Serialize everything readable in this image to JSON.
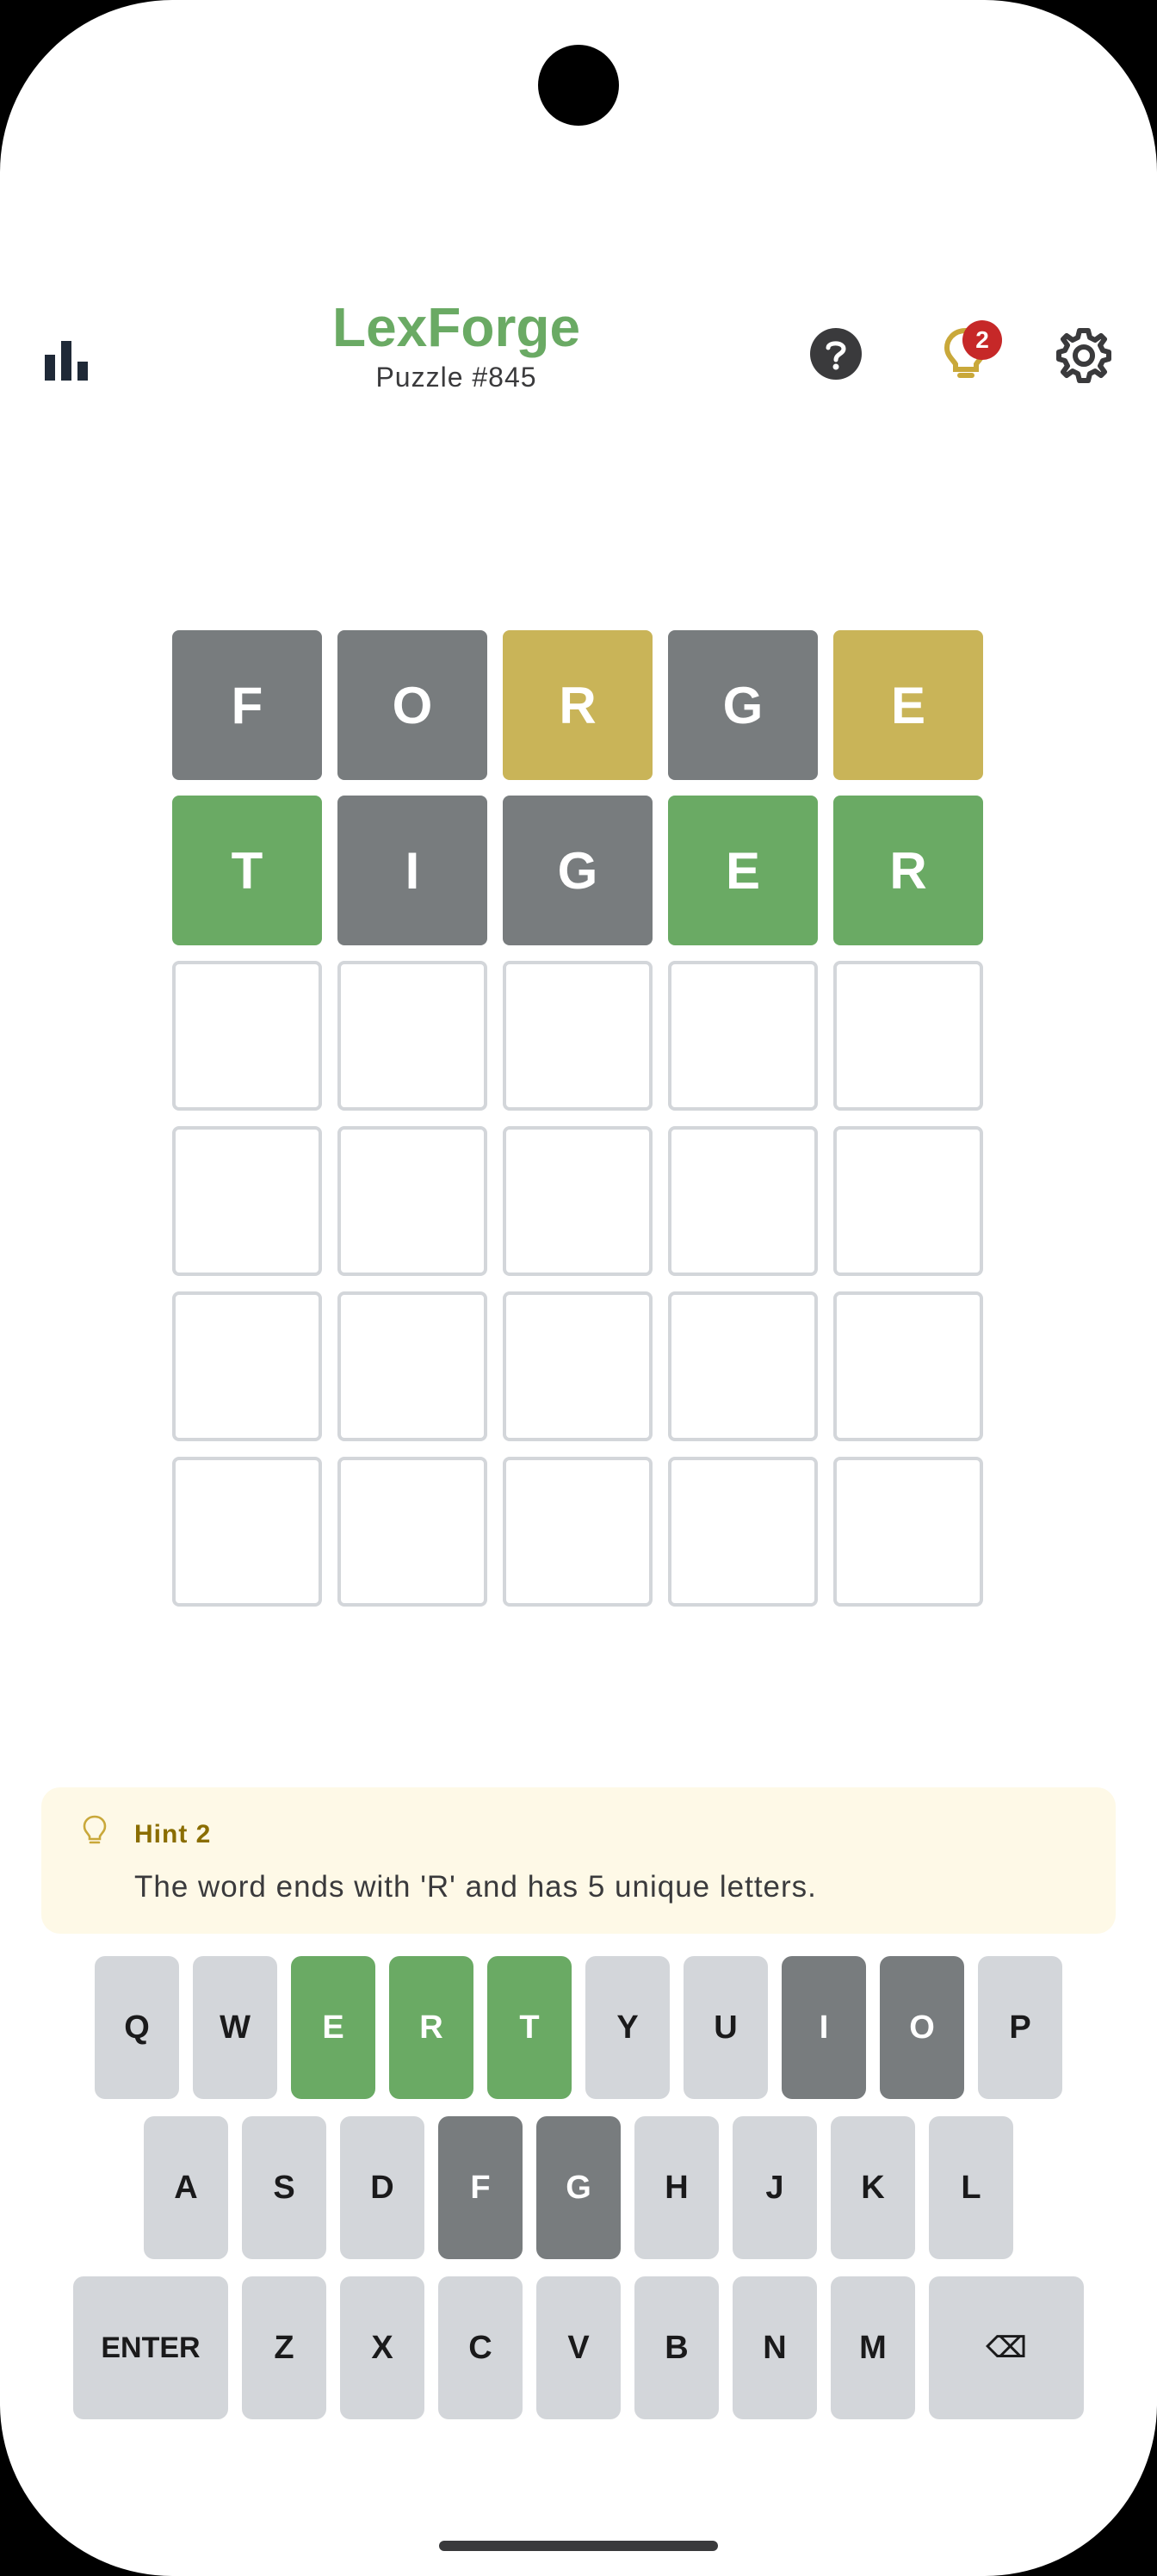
{
  "header": {
    "title": "LexForge",
    "puzzle": "Puzzle #845",
    "hint_badge": "2",
    "icons": {
      "stats": "bar-chart-icon",
      "help": "help-circle-icon",
      "hint": "lightbulb-icon",
      "settings": "gear-icon"
    }
  },
  "colors": {
    "correct": "#6aaa64",
    "present": "#c9b458",
    "absent": "#787c7e",
    "key_default": "#d3d6da",
    "badge": "#c62828"
  },
  "board": {
    "rows": [
      [
        {
          "letter": "F",
          "state": "absent"
        },
        {
          "letter": "O",
          "state": "absent"
        },
        {
          "letter": "R",
          "state": "present"
        },
        {
          "letter": "G",
          "state": "absent"
        },
        {
          "letter": "E",
          "state": "present"
        }
      ],
      [
        {
          "letter": "T",
          "state": "correct"
        },
        {
          "letter": "I",
          "state": "absent"
        },
        {
          "letter": "G",
          "state": "absent"
        },
        {
          "letter": "E",
          "state": "correct"
        },
        {
          "letter": "R",
          "state": "correct"
        }
      ],
      [
        {
          "letter": "",
          "state": "empty"
        },
        {
          "letter": "",
          "state": "empty"
        },
        {
          "letter": "",
          "state": "empty"
        },
        {
          "letter": "",
          "state": "empty"
        },
        {
          "letter": "",
          "state": "empty"
        }
      ],
      [
        {
          "letter": "",
          "state": "empty"
        },
        {
          "letter": "",
          "state": "empty"
        },
        {
          "letter": "",
          "state": "empty"
        },
        {
          "letter": "",
          "state": "empty"
        },
        {
          "letter": "",
          "state": "empty"
        }
      ],
      [
        {
          "letter": "",
          "state": "empty"
        },
        {
          "letter": "",
          "state": "empty"
        },
        {
          "letter": "",
          "state": "empty"
        },
        {
          "letter": "",
          "state": "empty"
        },
        {
          "letter": "",
          "state": "empty"
        }
      ],
      [
        {
          "letter": "",
          "state": "empty"
        },
        {
          "letter": "",
          "state": "empty"
        },
        {
          "letter": "",
          "state": "empty"
        },
        {
          "letter": "",
          "state": "empty"
        },
        {
          "letter": "",
          "state": "empty"
        }
      ]
    ]
  },
  "hint": {
    "label": "Hint 2",
    "text": "The word ends with 'R' and has 5 unique letters."
  },
  "keyboard": {
    "rows": [
      [
        {
          "k": "Q",
          "s": "default"
        },
        {
          "k": "W",
          "s": "default"
        },
        {
          "k": "E",
          "s": "correct"
        },
        {
          "k": "R",
          "s": "correct"
        },
        {
          "k": "T",
          "s": "correct"
        },
        {
          "k": "Y",
          "s": "default"
        },
        {
          "k": "U",
          "s": "default"
        },
        {
          "k": "I",
          "s": "absent"
        },
        {
          "k": "O",
          "s": "absent"
        },
        {
          "k": "P",
          "s": "default"
        }
      ],
      [
        {
          "k": "A",
          "s": "default"
        },
        {
          "k": "S",
          "s": "default"
        },
        {
          "k": "D",
          "s": "default"
        },
        {
          "k": "F",
          "s": "absent"
        },
        {
          "k": "G",
          "s": "absent"
        },
        {
          "k": "H",
          "s": "default"
        },
        {
          "k": "J",
          "s": "default"
        },
        {
          "k": "K",
          "s": "default"
        },
        {
          "k": "L",
          "s": "default"
        }
      ],
      [
        {
          "k": "ENTER",
          "s": "default",
          "wide": true
        },
        {
          "k": "Z",
          "s": "default"
        },
        {
          "k": "X",
          "s": "default"
        },
        {
          "k": "C",
          "s": "default"
        },
        {
          "k": "V",
          "s": "default"
        },
        {
          "k": "B",
          "s": "default"
        },
        {
          "k": "N",
          "s": "default"
        },
        {
          "k": "M",
          "s": "default"
        },
        {
          "k": "⌫",
          "s": "default",
          "wide": true
        }
      ]
    ]
  }
}
